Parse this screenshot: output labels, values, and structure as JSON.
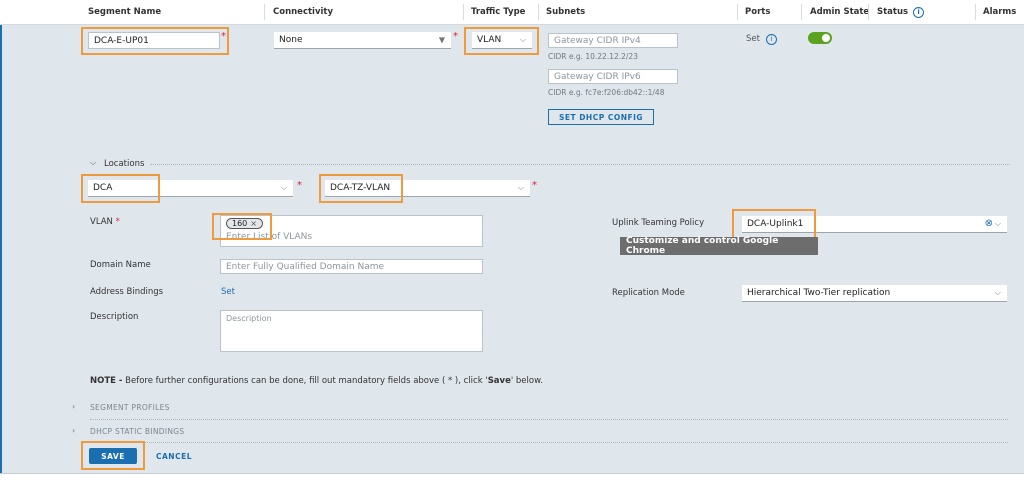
{
  "header": {
    "columns": [
      "Segment Name",
      "Connectivity",
      "Traffic Type",
      "Subnets",
      "Ports",
      "Admin State",
      "Status",
      "Alarms"
    ]
  },
  "segment": {
    "name_value": "DCA-E-UP01",
    "connectivity_value": "None",
    "traffic_type_value": "VLAN",
    "gateway_ipv4_placeholder": "Gateway CIDR IPv4",
    "ipv4_hint": "CIDR e.g. 10.22.12.2/23",
    "gateway_ipv6_placeholder": "Gateway CIDR IPv6",
    "ipv6_hint": "CIDR e.g. fc7e:f206:db42::1/48",
    "dhcp_button": "SET DHCP CONFIG",
    "ports_value": "Set",
    "admin_state_enabled": true
  },
  "locations": {
    "title": "Locations",
    "location_value": "DCA",
    "transport_zone_value": "DCA-TZ-VLAN"
  },
  "form": {
    "vlan_label": "VLAN",
    "vlan_chip": "160",
    "vlan_placeholder": "Enter List of VLANs",
    "domain_label": "Domain Name",
    "domain_placeholder": "Enter Fully Qualified Domain Name",
    "address_label": "Address Bindings",
    "address_link": "Set",
    "description_label": "Description",
    "description_placeholder": "Description",
    "uplink_label": "Uplink Teaming Policy",
    "uplink_value": "DCA-Uplink1",
    "replication_label": "Replication Mode",
    "replication_value": "Hierarchical Two-Tier replication",
    "tooltip": "Customize and control Google Chrome"
  },
  "note": {
    "prefix": "NOTE -",
    "text": " Before further configurations can be done, fill out mandatory fields above ( * ), click '",
    "save_word": "Save",
    "suffix": "' below."
  },
  "sections": {
    "segment_profiles": "SEGMENT PROFILES",
    "dhcp_static": "DHCP STATIC BINDINGS"
  },
  "actions": {
    "save": "SAVE",
    "cancel": "CANCEL"
  },
  "colors": {
    "accent": "#1a6fb0",
    "highlight": "#ee9a3d",
    "toggle_on": "#5aa220",
    "panel_bg": "#dfe6ec"
  }
}
